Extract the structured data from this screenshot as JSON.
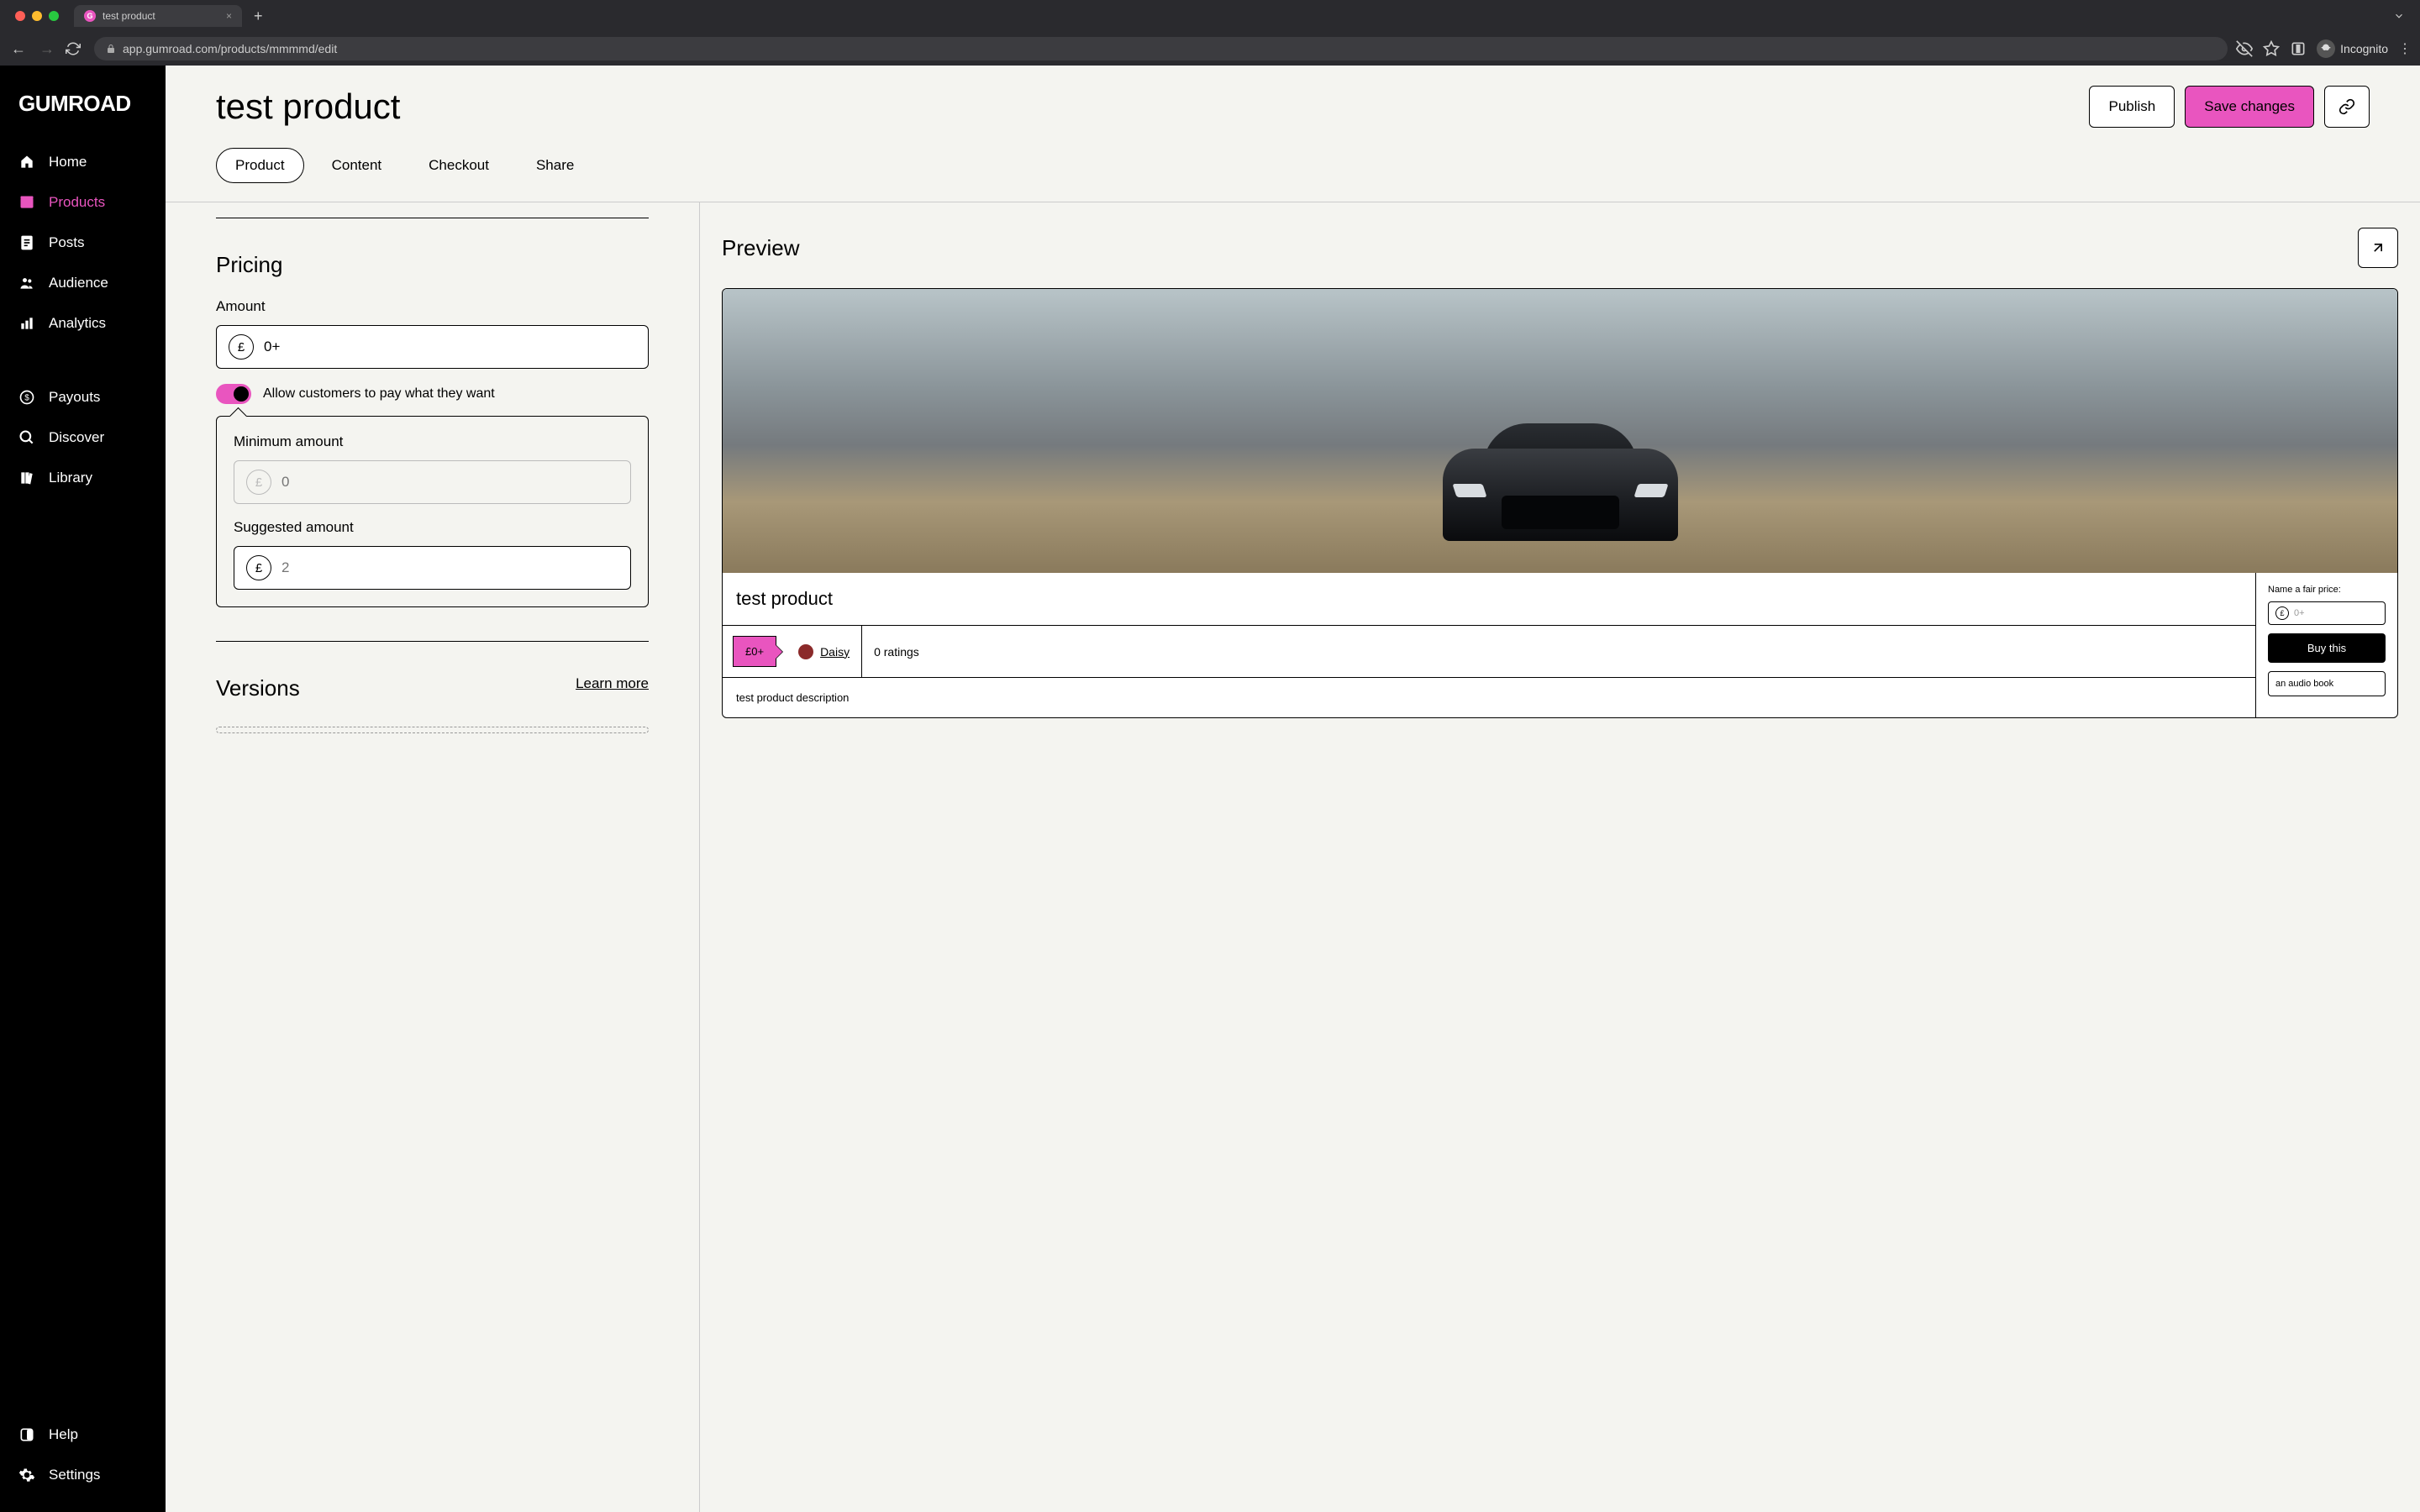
{
  "browser": {
    "tab_title": "test product",
    "url": "app.gumroad.com/products/mmmmd/edit",
    "incognito_label": "Incognito"
  },
  "sidebar": {
    "logo": "GUMROAD",
    "items": [
      {
        "label": "Home"
      },
      {
        "label": "Products"
      },
      {
        "label": "Posts"
      },
      {
        "label": "Audience"
      },
      {
        "label": "Analytics"
      },
      {
        "label": "Payouts"
      },
      {
        "label": "Discover"
      },
      {
        "label": "Library"
      },
      {
        "label": "Help"
      },
      {
        "label": "Settings"
      }
    ]
  },
  "header": {
    "title": "test product",
    "publish_label": "Publish",
    "save_label": "Save changes",
    "tabs": [
      {
        "label": "Product"
      },
      {
        "label": "Content"
      },
      {
        "label": "Checkout"
      },
      {
        "label": "Share"
      }
    ]
  },
  "pricing": {
    "section_title": "Pricing",
    "amount_label": "Amount",
    "currency": "£",
    "amount_value": "0+",
    "toggle_label": "Allow customers to pay what they want",
    "min_label": "Minimum amount",
    "min_placeholder": "0",
    "suggested_label": "Suggested amount",
    "suggested_placeholder": "2"
  },
  "versions": {
    "section_title": "Versions",
    "learn_more": "Learn more"
  },
  "preview": {
    "title": "Preview",
    "product_title": "test product",
    "price_badge": "£0+",
    "seller_name": "Daisy",
    "ratings": "0 ratings",
    "description": "test product description",
    "fair_price_label": "Name a fair price:",
    "fair_price_currency": "£",
    "fair_price_placeholder": "0+",
    "buy_label": "Buy this",
    "bonus": "an audio book"
  }
}
